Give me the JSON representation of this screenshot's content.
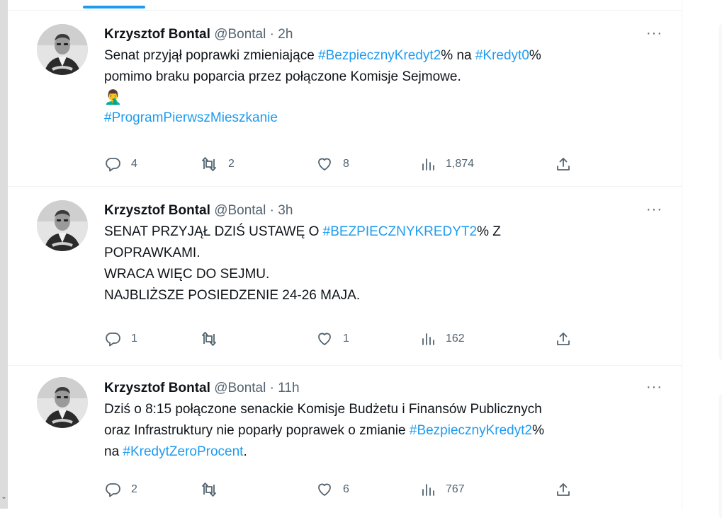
{
  "tweets": [
    {
      "author": "Krzysztof Bontal",
      "handle": "@Bontal",
      "separator": "·",
      "time": "2h",
      "more": "···",
      "lines": [
        [
          {
            "t": "Senat przyjął poprawki zmieniające "
          },
          {
            "t": "#BezpiecznyKredyt2",
            "tag": true
          },
          {
            "t": "% na "
          },
          {
            "t": "#Kredyt0",
            "tag": true
          },
          {
            "t": "%"
          }
        ],
        [
          {
            "t": "pomimo braku poparcia przez połączone Komisje Sejmowe."
          }
        ]
      ],
      "emoji": "🤦‍♂️",
      "trailing_hashtag": "#ProgramPierwszMieszkanie",
      "replies": "4",
      "retweets": "2",
      "likes": "8",
      "views": "1,874"
    },
    {
      "author": "Krzysztof Bontal",
      "handle": "@Bontal",
      "separator": "·",
      "time": "3h",
      "more": "···",
      "lines": [
        [
          {
            "t": "SENAT PRZYJĄŁ DZIŚ USTAWĘ O "
          },
          {
            "t": "#BEZPIECZNYKREDYT2",
            "tag": true
          },
          {
            "t": "% Z"
          }
        ],
        [
          {
            "t": "POPRAWKAMI."
          }
        ],
        [
          {
            "t": "WRACA WIĘC DO SEJMU."
          }
        ],
        [
          {
            "t": "NAJBLIŻSZE POSIEDZENIE 24-26 MAJA."
          }
        ]
      ],
      "replies": "1",
      "retweets": "",
      "likes": "1",
      "views": "162"
    },
    {
      "author": "Krzysztof Bontal",
      "handle": "@Bontal",
      "separator": "·",
      "time": "11h",
      "more": "···",
      "lines": [
        [
          {
            "t": "Dziś o 8:15 połączone senackie Komisje Budżetu i Finansów Publicznych"
          }
        ],
        [
          {
            "t": "oraz Infrastruktury nie poparły poprawek o zmianie "
          },
          {
            "t": "#BezpiecznyKredyt2",
            "tag": true
          },
          {
            "t": "%"
          }
        ],
        [
          {
            "t": "na "
          },
          {
            "t": "#KredytZeroProcent",
            "tag": true
          },
          {
            "t": "."
          }
        ]
      ],
      "replies": "2",
      "retweets": "",
      "likes": "6",
      "views": "767"
    }
  ],
  "icons": {
    "reply": "reply-icon",
    "retweet": "retweet-icon",
    "like": "heart-icon",
    "views": "views-icon",
    "share": "share-icon"
  },
  "colors": {
    "accent": "#1d9bf0",
    "text": "#0f1419",
    "muted": "#536471"
  }
}
